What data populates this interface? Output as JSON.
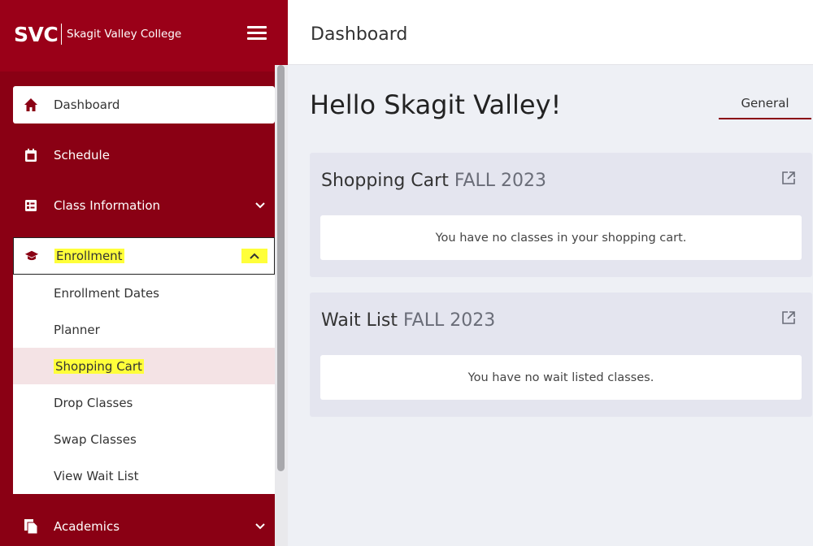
{
  "brand": {
    "logo": "SVC",
    "name": "Skagit Valley College"
  },
  "topbar": {
    "title": "Dashboard"
  },
  "nav": {
    "dashboard": "Dashboard",
    "schedule": "Schedule",
    "class_information": "Class Information",
    "enrollment": "Enrollment",
    "academics": "Academics"
  },
  "enrollment_submenu": [
    "Enrollment Dates",
    "Planner",
    "Shopping Cart",
    "Drop Classes",
    "Swap Classes",
    "View Wait List"
  ],
  "main": {
    "greeting": "Hello Skagit Valley!",
    "tab": "General",
    "shopping_cart": {
      "title": "Shopping Cart",
      "term": "FALL 2023",
      "message": "You have no classes in your shopping cart."
    },
    "wait_list": {
      "title": "Wait List",
      "term": "FALL 2023",
      "message": "You have no wait listed classes."
    }
  },
  "icons": {
    "dashboard": "home-icon",
    "schedule": "calendar-icon",
    "class_information": "list-card-icon",
    "enrollment": "graduation-cap-icon",
    "academics": "documents-icon",
    "external": "external-link-icon"
  },
  "colors": {
    "brand": "#8a0014",
    "highlight": "#ffff3a",
    "active_bg": "#f4e3e5"
  }
}
